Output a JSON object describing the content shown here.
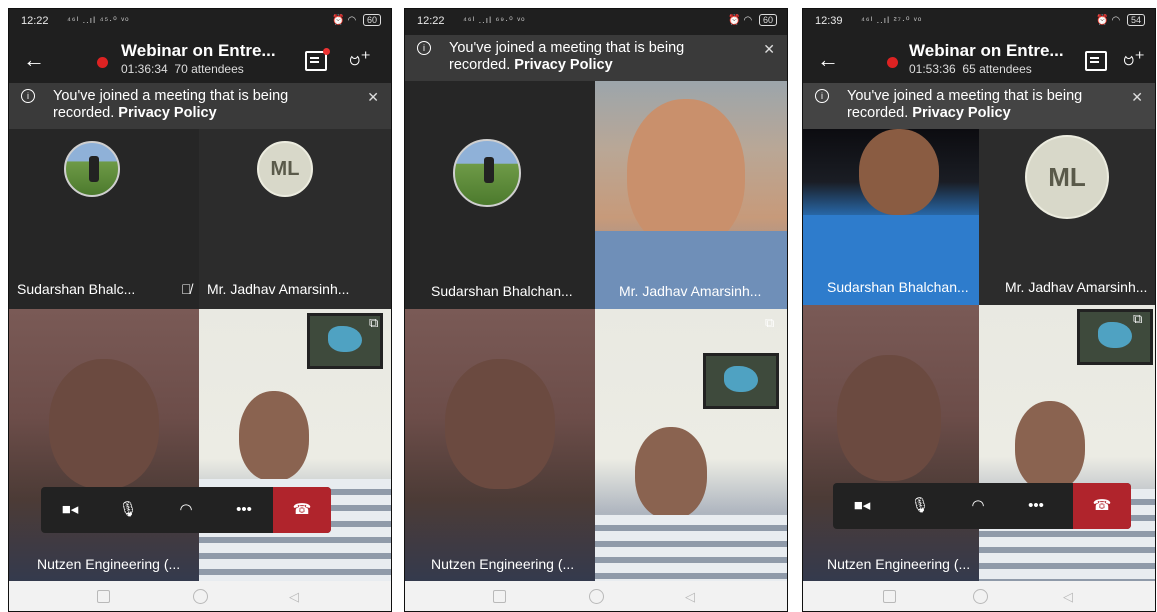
{
  "panels": [
    {
      "status": {
        "time": "12:22",
        "signal": "⁴⁶ᴵ ..ıl ⁴⁵·⁰ ᵛᵒ",
        "battery": "60"
      },
      "header": {
        "back_icon": "arrow-left-icon",
        "title": "Webinar on Entre...",
        "timer": "01:36:34",
        "attendees": "70 attendees"
      },
      "banner": {
        "text": "You've joined a meeting that is being recorded.",
        "link": "Privacy Policy"
      },
      "tiles": [
        {
          "name": "Sudarshan Bhalc...",
          "muted": true
        },
        {
          "name": "Mr. Jadhav Amarsinh...",
          "initials": "ML"
        },
        {
          "name": "Nutzen Engineering (..."
        }
      ]
    },
    {
      "status": {
        "time": "12:22",
        "signal": "⁴⁶ᴵ ..ıl ⁶⁹·⁰ ᵛᵒ",
        "battery": "60"
      },
      "banner": {
        "text": "You've joined a meeting that is being recorded.",
        "link": "Privacy Policy"
      },
      "tiles": [
        {
          "name": "Sudarshan Bhalchan..."
        },
        {
          "name": "Mr. Jadhav Amarsinh..."
        },
        {
          "name": "Nutzen Engineering (..."
        }
      ]
    },
    {
      "status": {
        "time": "12:39",
        "signal": "⁴⁶ᴵ ..ıl ²⁷·⁰ ᵛᵒ",
        "battery": "54"
      },
      "header": {
        "title": "Webinar on Entre...",
        "timer": "01:53:36",
        "attendees": "65 attendees"
      },
      "banner": {
        "text": "You've joined a meeting that is being recorded.",
        "link": "Privacy Policy"
      },
      "tiles": [
        {
          "name": "Sudarshan Bhalchan..."
        },
        {
          "name": "Mr. Jadhav Amarsinh...",
          "initials": "ML"
        },
        {
          "name": "Nutzen Engineering (..."
        }
      ]
    }
  ],
  "colors": {
    "end_call": "#b0242c",
    "record_dot": "#dd2222"
  },
  "controls": [
    "video-camera-icon",
    "microphone-icon",
    "speaker-icon",
    "more-options-icon",
    "end-call-icon"
  ]
}
